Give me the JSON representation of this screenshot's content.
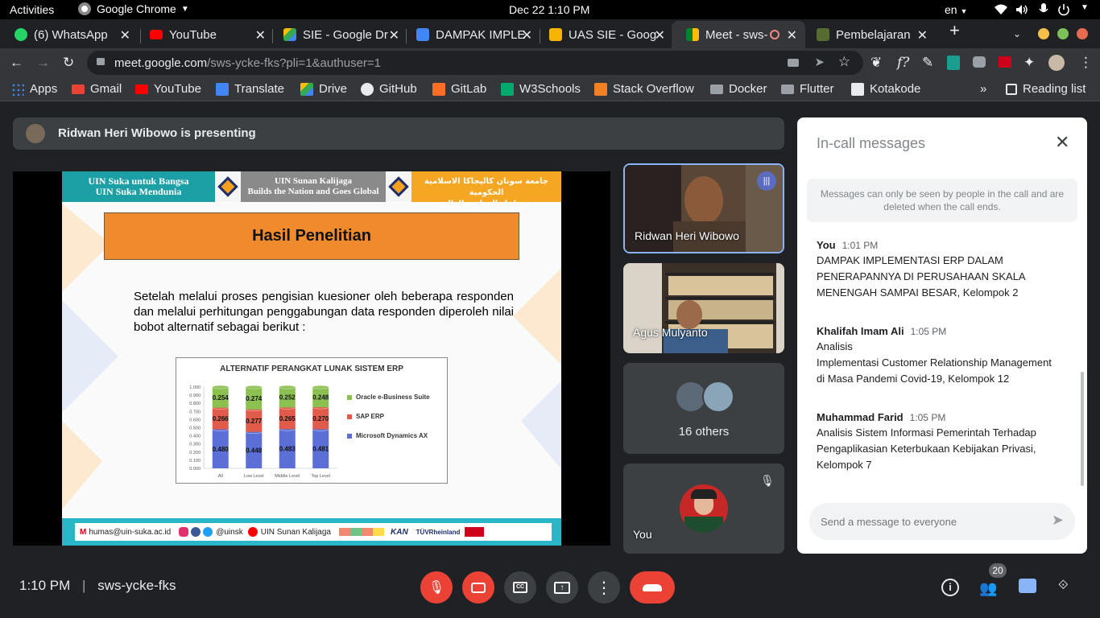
{
  "system_bar": {
    "activities": "Activities",
    "app_name": "Google Chrome",
    "datetime": "Dec 22  1:10 PM",
    "lang": "en"
  },
  "tabs": [
    {
      "title": "(6) WhatsApp",
      "color": "#25d366"
    },
    {
      "title": "YouTube",
      "color": "#ff0000"
    },
    {
      "title": "SIE - Google Dr",
      "color": "#fbbc04"
    },
    {
      "title": "DAMPAK IMPLE",
      "color": "#4285f4"
    },
    {
      "title": "UAS SIE - Goog",
      "color": "#f4b400"
    },
    {
      "title": "Meet - sws-",
      "color": "#00832d"
    },
    {
      "title": "Pembelajaran",
      "color": "#556b2f"
    }
  ],
  "address": {
    "host": "meet.google.com",
    "path": "/sws-ycke-fks?pli=1&authuser=1"
  },
  "bookmarks": [
    {
      "label": "Apps",
      "color": "#4285f4"
    },
    {
      "label": "Gmail",
      "color": "#ea4335"
    },
    {
      "label": "YouTube",
      "color": "#ff0000"
    },
    {
      "label": "Translate",
      "color": "#4285f4"
    },
    {
      "label": "Drive",
      "color": "#fbbc04"
    },
    {
      "label": "GitHub",
      "color": "#e8eaed"
    },
    {
      "label": "GitLab",
      "color": "#fc6d26"
    },
    {
      "label": "W3Schools",
      "color": "#04aa6d"
    },
    {
      "label": "Stack Overflow",
      "color": "#f48024"
    },
    {
      "label": "Docker",
      "color": "#9aa0a6"
    },
    {
      "label": "Flutter",
      "color": "#9aa0a6"
    },
    {
      "label": "Kotakode",
      "color": "#e8eaed"
    }
  ],
  "reading_list": "Reading list",
  "presenting": "Ridwan Heri Wibowo is presenting",
  "slide": {
    "header_left": [
      "UIN Suka untuk Bangsa",
      "UIN Suka Mendunia"
    ],
    "header_mid": [
      "UIN Sunan Kalijaga",
      "Builds the Nation and Goes Global"
    ],
    "header_right": [
      "جامعة سونان كاليجاكا الاسلامية الحكومية",
      "من اجل الوطن والعالم"
    ],
    "title": "Hasil Penelitian",
    "body": "Setelah melalui proses pengisian kuesioner oleh beberapa responden dan melalui perhitungan penggabungan data responden diperoleh nilai bobot alternatif sebagai berikut :",
    "footer_email": "humas@uin-suka.ac.id",
    "footer_social": "@uinsk",
    "footer_channel": "UIN Sunan Kalijaga",
    "footer_logos": [
      "KAN",
      "TÜVRheinland"
    ],
    "chart": {
      "type": "bar",
      "title": "ALTERNATIF PERANGKAT LUNAK SISTEM ERP",
      "categories": [
        "All",
        "Low Level",
        "Middle Level",
        "Top Level"
      ],
      "y_ticks": [
        "1.000",
        "0.900",
        "0.800",
        "0.700",
        "0.600",
        "0.500",
        "0.400",
        "0.300",
        "0.200",
        "0.100",
        "0.000"
      ],
      "ylim": [
        0,
        1
      ],
      "series": [
        {
          "name": "Microsoft Dynamics AX",
          "color": "#5b6fd6",
          "values": [
            0.48,
            0.448,
            0.483,
            0.481
          ],
          "labels": [
            "0.480",
            "0.448",
            "0.483",
            "0.481"
          ]
        },
        {
          "name": "SAP ERP",
          "color": "#e15b4a",
          "values": [
            0.266,
            0.277,
            0.265,
            0.27
          ],
          "labels": [
            "0.266",
            "0.277",
            "0.265",
            "0.270"
          ]
        },
        {
          "name": "Oracle e-Business Suite",
          "color": "#8cc152",
          "values": [
            0.254,
            0.274,
            0.252,
            0.248
          ],
          "labels": [
            "0.254",
            "0.274",
            "0.252",
            "0.248"
          ]
        }
      ],
      "legend": [
        "Oracle e-Business Suite",
        "SAP ERP",
        "Microsoft Dynamics AX"
      ]
    }
  },
  "participants": {
    "p1": "Ridwan Heri Wibowo",
    "p2": "Agus Mulyanto",
    "others": "16 others",
    "you": "You"
  },
  "chat": {
    "title": "In-call messages",
    "notice": "Messages can only be seen by people in the call and are deleted when the call ends.",
    "messages": [
      {
        "name": "You",
        "time": "1:01 PM",
        "lines": [
          "DAMPAK IMPLEMENTASI ERP DALAM",
          "PENERAPANNYA DI PERUSAHAAN SKALA",
          "MENENGAH SAMPAI BESAR, Kelompok 2"
        ]
      },
      {
        "name": "Khalifah Imam Ali",
        "time": "1:05 PM",
        "lines": [
          "Analisis",
          "Implementasi Customer Relationship Management",
          "di Masa Pandemi Covid-19, Kelompok 12"
        ]
      },
      {
        "name": "Muhammad Farid",
        "time": "1:05 PM",
        "lines": [
          "Analisis Sistem Informasi Pemerintah Terhadap",
          "Pengaplikasian Keterbukaan Kebijakan Privasi,",
          "Kelompok 7"
        ]
      }
    ],
    "input_placeholder": "Send a message to everyone"
  },
  "bottom": {
    "time": "1:10 PM",
    "meeting_code": "sws-ycke-fks",
    "participant_count": "20"
  }
}
